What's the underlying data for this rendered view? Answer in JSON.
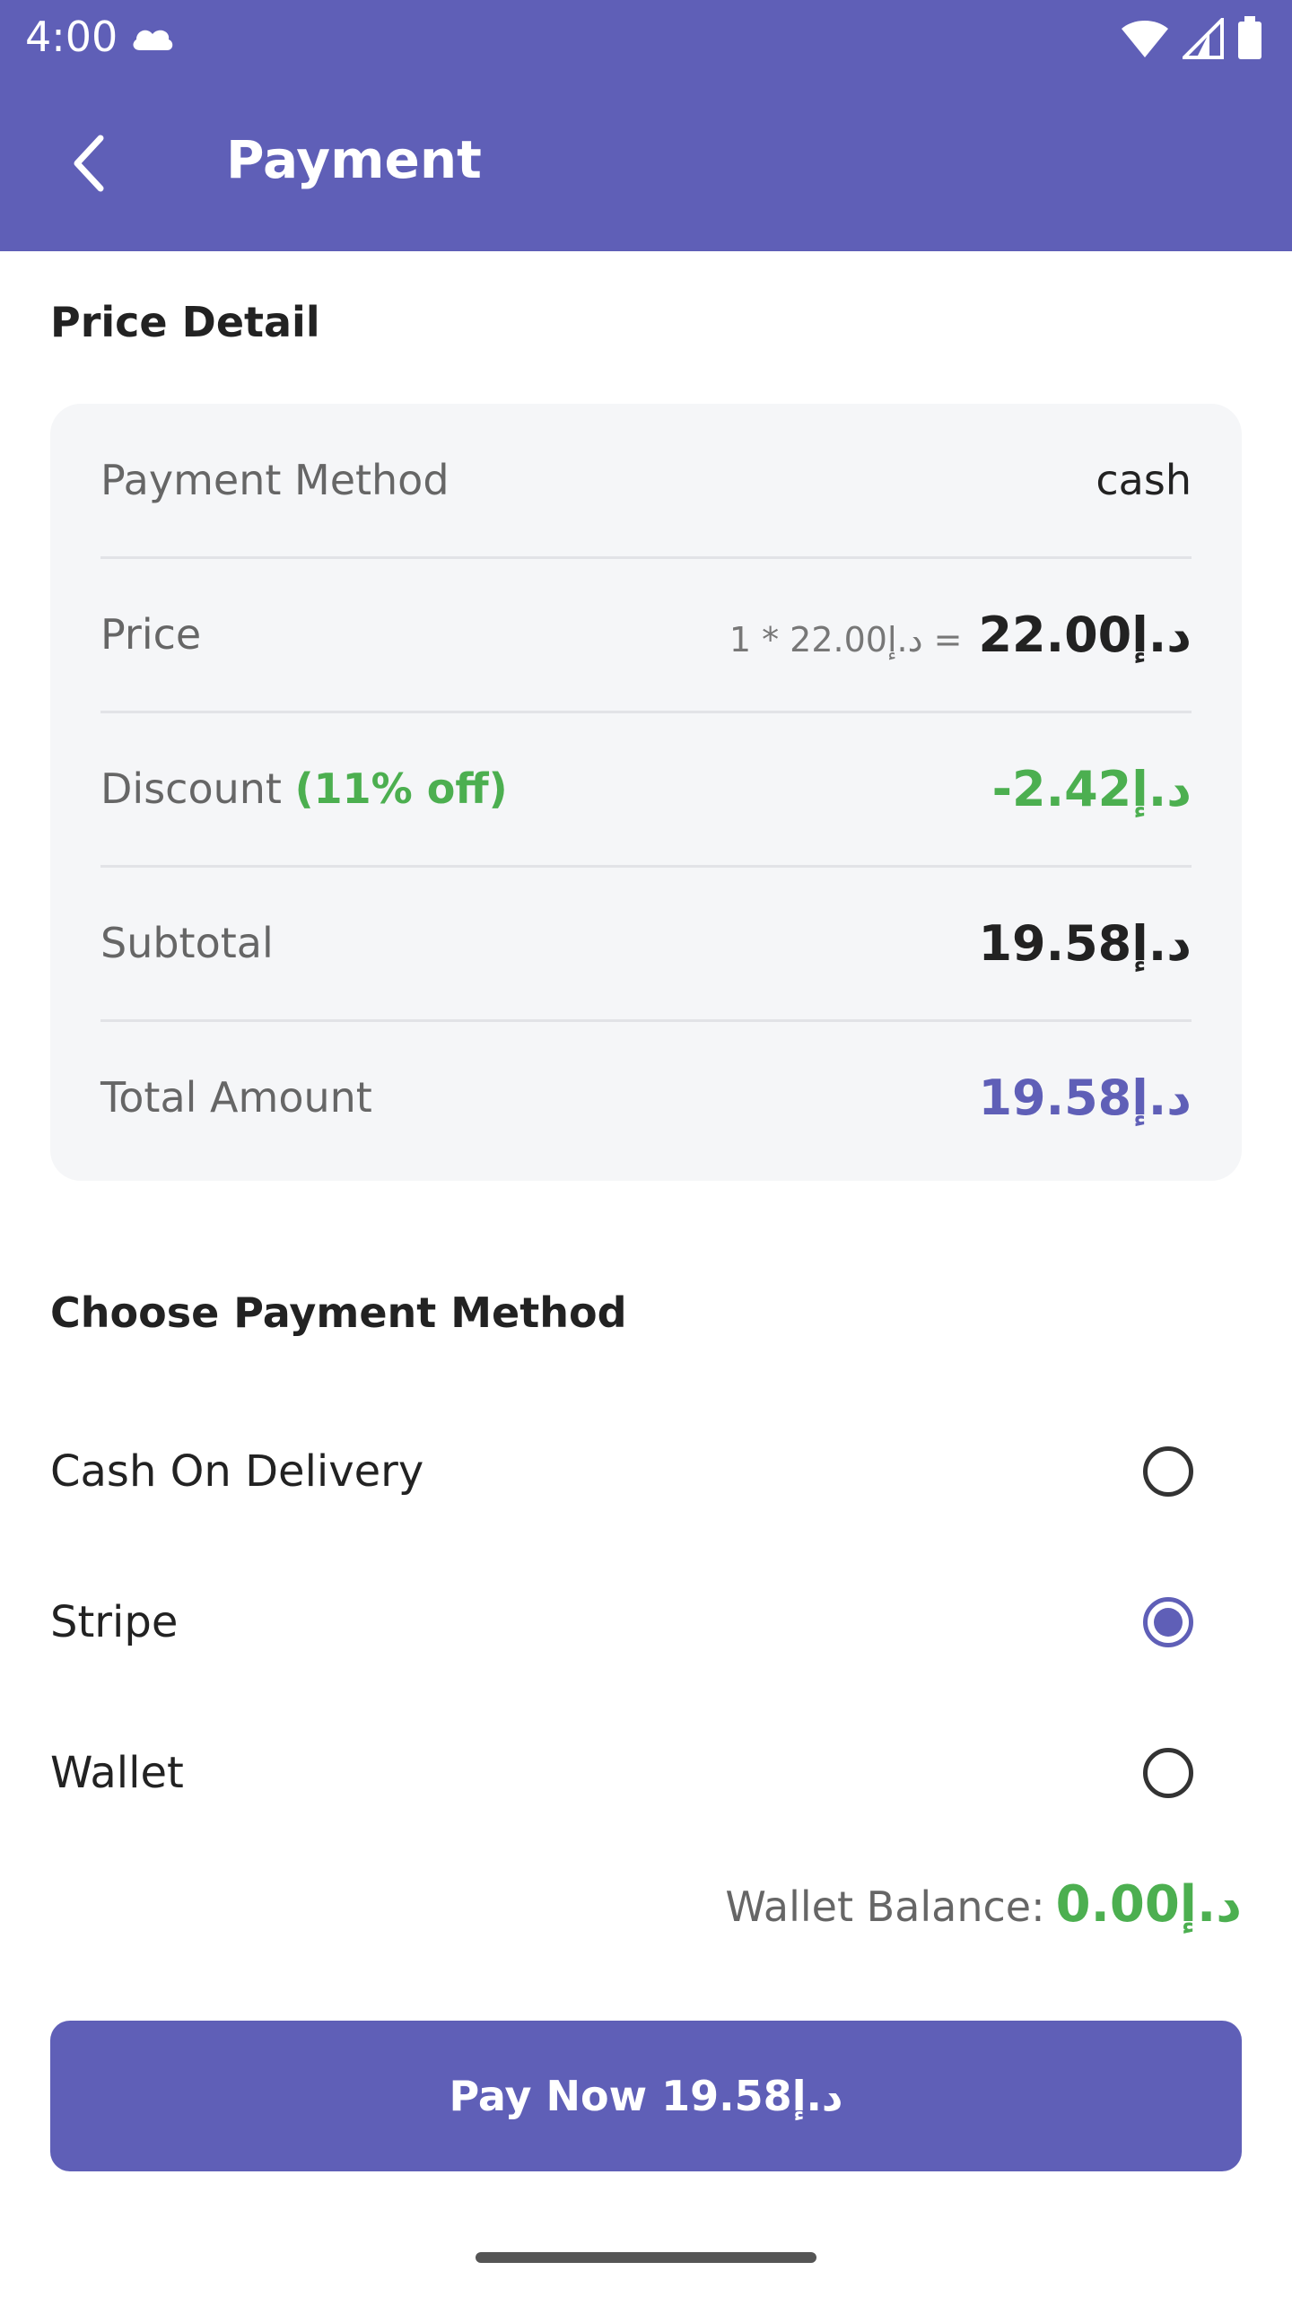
{
  "status_bar": {
    "time": "4:00",
    "icons": [
      "cloud-icon",
      "wifi-icon",
      "signal-icon",
      "battery-icon"
    ]
  },
  "app_bar": {
    "back_icon": "chevron-left-icon",
    "title": "Payment"
  },
  "price_detail": {
    "title": "Price Detail",
    "rows": [
      {
        "label": "Payment Method",
        "value": "cash"
      },
      {
        "label": "Price",
        "calc": "1 * د.إ22.00 =",
        "value": "د.إ22.00"
      },
      {
        "label": "Discount",
        "badge": "(11% off)",
        "value": "-2.42د.إ"
      },
      {
        "label": "Subtotal",
        "value": "د.إ19.58"
      },
      {
        "label": "Total Amount",
        "value": "د.إ19.58"
      }
    ]
  },
  "payment_methods": {
    "title": "Choose Payment Method",
    "options": [
      {
        "label": "Cash On Delivery",
        "selected": false
      },
      {
        "label": "Stripe",
        "selected": true
      },
      {
        "label": "Wallet",
        "selected": false
      }
    ],
    "wallet_balance_label": "Wallet Balance:",
    "wallet_balance_value": "د.إ0.00"
  },
  "pay_button": {
    "label": "Pay Now د.إ19.58"
  },
  "colors": {
    "primary": "#5f5fb7",
    "green": "#4caf50",
    "card_bg": "#f5f6f8"
  }
}
